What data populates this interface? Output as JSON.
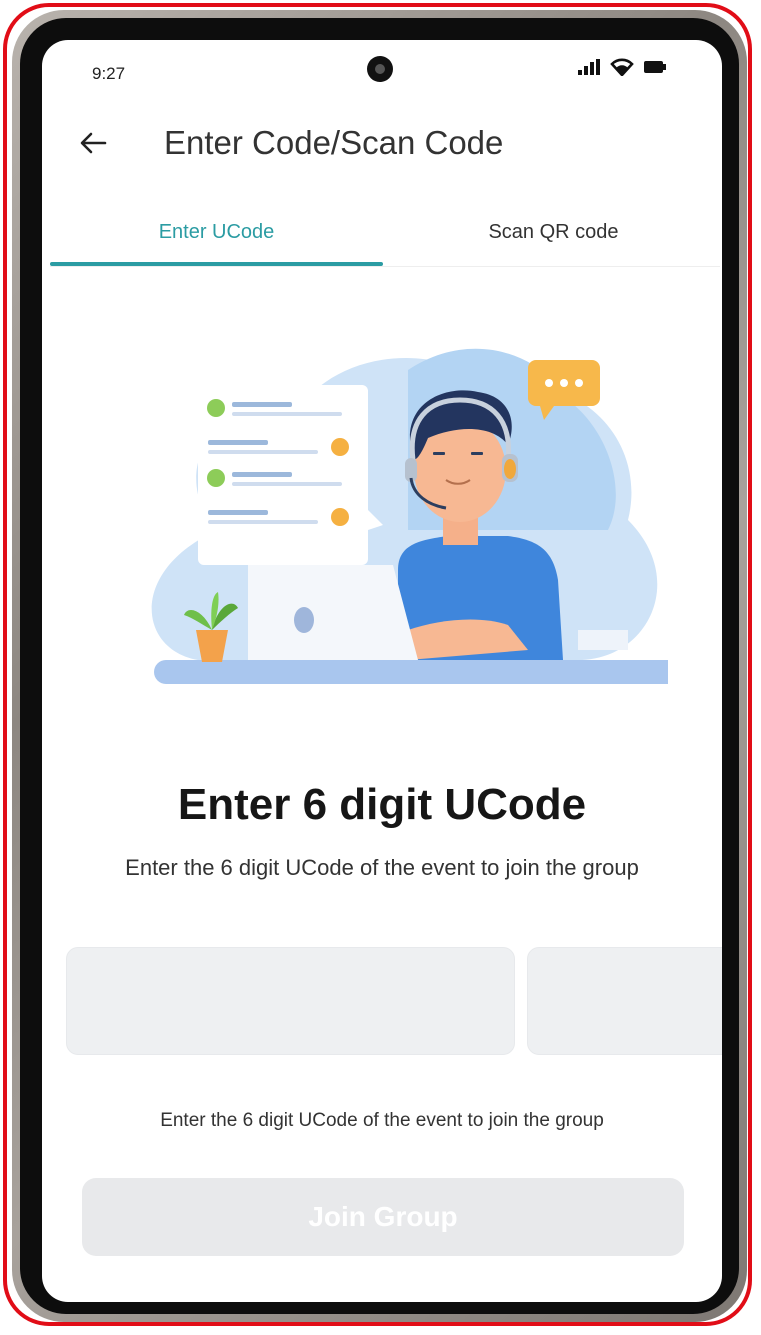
{
  "status_bar": {
    "time": "9:27"
  },
  "appbar": {
    "title": "Enter Code/Scan Code"
  },
  "tabs": [
    {
      "label": "Enter UCode",
      "active": true
    },
    {
      "label": "Scan QR code",
      "active": false
    }
  ],
  "main": {
    "heading": "Enter 6 digit UCode",
    "subheading": "Enter the 6 digit UCode of the event to join the group",
    "code_boxes": [
      "",
      "",
      "",
      "",
      "",
      ""
    ],
    "helper_text": "Enter the 6 digit UCode of the event to join the group",
    "join_button": "Join Group"
  },
  "colors": {
    "accent": "#2b9ca3",
    "frame_highlight": "#e10d17",
    "disabled_button": "#e8e9eb"
  },
  "icons": [
    "back-arrow-icon",
    "signal-icon",
    "wifi-icon",
    "battery-icon",
    "camera-icon"
  ]
}
